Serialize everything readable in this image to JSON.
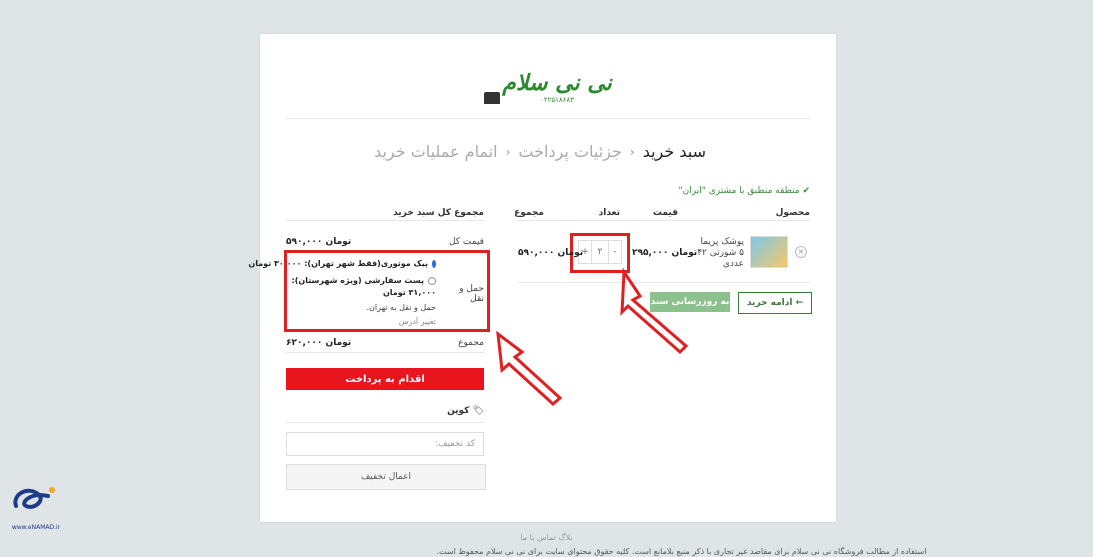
{
  "logo": {
    "main": "نی نی سلام",
    "sub": "۰۲۲۵۱۸۶۸۳"
  },
  "steps": {
    "cart": "سبد خرید",
    "details": "جزئیات پرداخت",
    "complete": "اتمام عملیات خرید",
    "separator": "‹"
  },
  "notice": "منطقه منطبق با مشتری \"ایران\"",
  "cart": {
    "headers": {
      "product": "محصول",
      "price": "قیمت",
      "quantity": "تعداد",
      "subtotal": "مجموع"
    },
    "item": {
      "name_line1": "پوشک پریما",
      "name_line2": "۵ شورتی ۴۲",
      "name_line3": "عددی",
      "price": "۲۹۵,۰۰۰ تومان",
      "quantity": "۲",
      "plus": "+",
      "minus": "-",
      "subtotal": "۵۹۰,۰۰۰ تومان",
      "remove": "×"
    },
    "continue_button": "← ادامه خرید",
    "update_button": "به روزرسانی سبد"
  },
  "totals": {
    "title": "مجموع کل سبد خرید",
    "subtotal_label": "قیمت کل",
    "subtotal_value": "۵۹۰,۰۰۰ تومان",
    "shipping_label": "حمل و نقل",
    "option1": "پیک موتوری(فقط شهر تهران): ۳۰,۰۰۰ تومان",
    "option2_line1": "پست سفارشی (ویژه شهرستان):",
    "option2_line2": "۳۱,۰۰۰ تومان",
    "shipping_to": "حمل و نقل به تهران.",
    "change_address": "تغییر آدرس",
    "total_label": "مجموع",
    "total_value": "۶۲۰,۰۰۰ تومان",
    "checkout_button": "اقدام به پرداخت"
  },
  "coupon": {
    "title": "کوپن",
    "placeholder": "کد تخفیف:",
    "apply_button": "اعمال تخفیف"
  },
  "footer": {
    "links": "بلاگ   تماس با ما",
    "copyright": "استفاده از مطالب فروشگاه نی نی سلام برای مقاصد غیر تجاری با ذکر منبع بلامانع است. کلیه حقوق محتوای سایت برای نی نی سلام محفوظ است."
  },
  "badge": {
    "site": "www.eNAMAD.ir"
  },
  "colors": {
    "accent_red": "#e8141e",
    "brand_green": "#2c8a2c",
    "annotation_red": "#e02020"
  }
}
